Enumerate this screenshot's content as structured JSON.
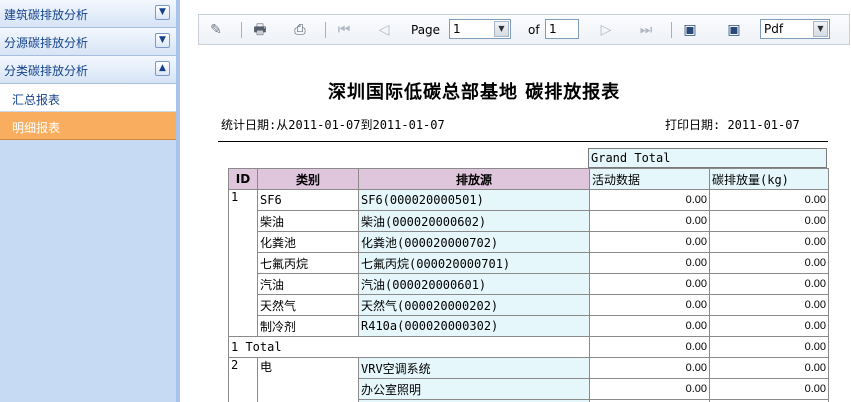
{
  "sidebar": {
    "groups": [
      {
        "label": "建筑碳排放分析",
        "toggle": "▼"
      },
      {
        "label": "分源碳排放分析",
        "toggle": "▼"
      },
      {
        "label": "分类碳排放分析",
        "toggle": "▲"
      }
    ],
    "items": [
      {
        "label": "汇总报表",
        "selected": false
      },
      {
        "label": "明细报表",
        "selected": true
      }
    ]
  },
  "toolbar": {
    "page_label": "Page",
    "page_value": "1",
    "of_label": "of",
    "total_pages": "1",
    "format_value": "Pdf",
    "icons": [
      "edit-icon",
      "print-icon",
      "export-icon",
      "first-page-icon",
      "prev-page-icon",
      "next-page-icon",
      "last-page-icon",
      "save-icon",
      "save-as-icon"
    ]
  },
  "report": {
    "title": "深圳国际低碳总部基地 碳排放报表",
    "stat_date": "统计日期:从2011-01-07到2011-01-07",
    "print_date": "打印日期: 2011-01-07",
    "grand_total_label": "Grand Total",
    "columns": {
      "id": "ID",
      "category": "类别",
      "source": "排放源",
      "activity": "活动数据",
      "emission": "碳排放量(kg)"
    },
    "groups": [
      {
        "id": "1",
        "rows": [
          {
            "category": "SF6",
            "source": "SF6(000020000501)",
            "activity": "0.00",
            "emission": "0.00"
          },
          {
            "category": "柴油",
            "source": "柴油(000020000602)",
            "activity": "0.00",
            "emission": "0.00"
          },
          {
            "category": "化粪池",
            "source": "化粪池(000020000702)",
            "activity": "0.00",
            "emission": "0.00"
          },
          {
            "category": "七氟丙烷",
            "source": "七氟丙烷(000020000701)",
            "activity": "0.00",
            "emission": "0.00"
          },
          {
            "category": "汽油",
            "source": "汽油(000020000601)",
            "activity": "0.00",
            "emission": "0.00"
          },
          {
            "category": "天然气",
            "source": "天然气(000020000202)",
            "activity": "0.00",
            "emission": "0.00"
          },
          {
            "category": "制冷剂",
            "source": "R410a(000020000302)",
            "activity": "0.00",
            "emission": "0.00"
          }
        ],
        "total_label": "1 Total",
        "total_activity": "0.00",
        "total_emission": "0.00"
      },
      {
        "id": "2",
        "rows": [
          {
            "category": "电",
            "source": "VRV空调系统",
            "activity": "0.00",
            "emission": "0.00"
          },
          {
            "category": "",
            "source": "办公室照明",
            "activity": "0.00",
            "emission": "0.00"
          }
        ]
      }
    ]
  },
  "colors": {
    "sidebar_bg": "#c7daf3",
    "selected_item": "#f9ad5e",
    "header_pink": "#dfc6dc",
    "header_blue": "#e6f7fb"
  }
}
